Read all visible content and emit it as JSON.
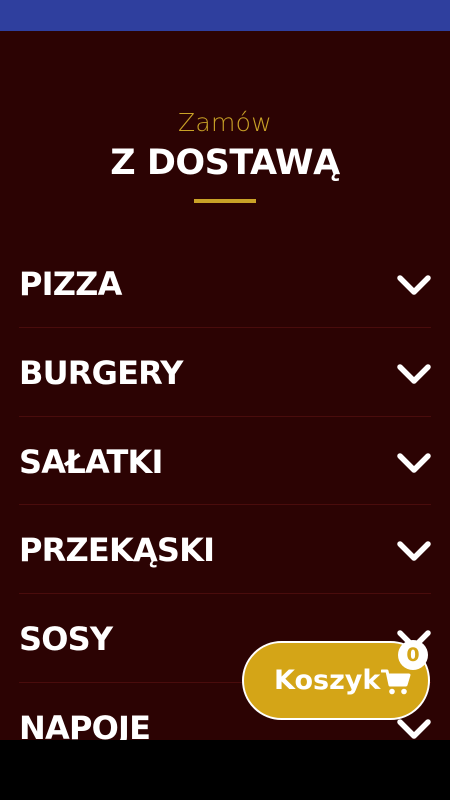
{
  "header": {
    "subtitle": "Zamów",
    "title": "Z DOSTAWĄ"
  },
  "menu": {
    "items": [
      {
        "label": "PIZZA",
        "icon": "chevron-down-icon"
      },
      {
        "label": "BURGERY",
        "icon": "chevron-down-icon"
      },
      {
        "label": "SAŁATKI",
        "icon": "chevron-down-icon"
      },
      {
        "label": "PRZEKĄSKI",
        "icon": "chevron-down-icon"
      },
      {
        "label": "SOSY",
        "icon": "chevron-down-icon"
      },
      {
        "label": "NAPOJE",
        "icon": "chevron-down-icon"
      }
    ]
  },
  "cart": {
    "label": "Koszyk",
    "count": "0",
    "icon": "shopping-cart-icon"
  },
  "colors": {
    "status_bar": "#2f3f9e",
    "background": "#2c0303",
    "accent": "#c9a227",
    "cart_button": "#d4a517",
    "text": "#ffffff"
  }
}
